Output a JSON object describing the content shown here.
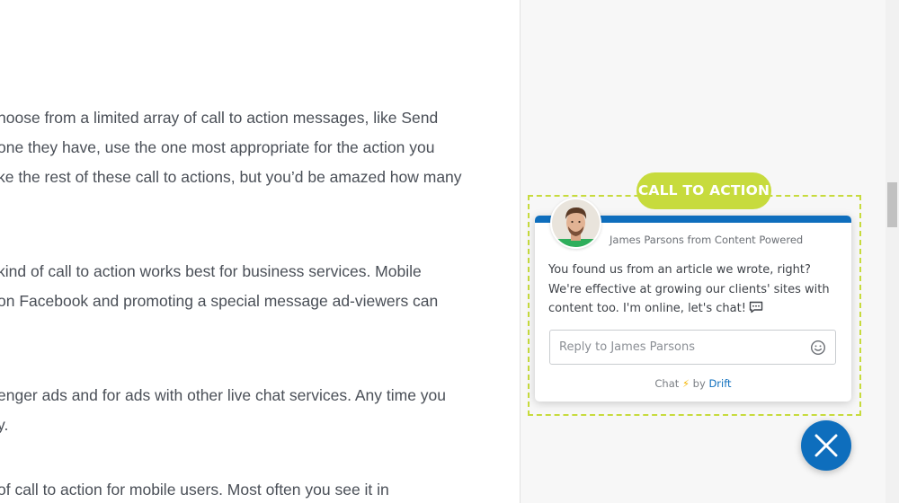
{
  "article": {
    "lines": [
      "hoose from a limited array of call to action messages, like Send",
      " one they have, use the one most appropriate for the action you",
      "ke the rest of these call to actions, but you’d be amazed how many",
      "kind of call to action works best for business services. Mobile",
      "on Facebook and promoting a special message ad-viewers can",
      "enger ads and for ads with other live chat services. Any time you",
      "y.",
      " of call to action for mobile users. Most often you see it in"
    ]
  },
  "cta": {
    "badge_label": "CALL TO ACTION",
    "accent_color": "#c7db3d"
  },
  "chat": {
    "sender": "James Parsons from Content Powered",
    "message_lines": [
      "You found us from an article we wrote, right?",
      "We're effective at growing our clients' sites with",
      "content too. I'm online, let's chat!"
    ],
    "reply_placeholder": "Reply to James Parsons",
    "powered_prefix": "Chat",
    "powered_by": "by",
    "powered_brand": "Drift",
    "brand_color": "#0e6ebd",
    "icons": {
      "avatar": "avatar-photo",
      "chat": "chat-bubble-icon",
      "emoji": "smile-icon",
      "bolt": "bolt-icon",
      "close": "close-icon"
    }
  }
}
